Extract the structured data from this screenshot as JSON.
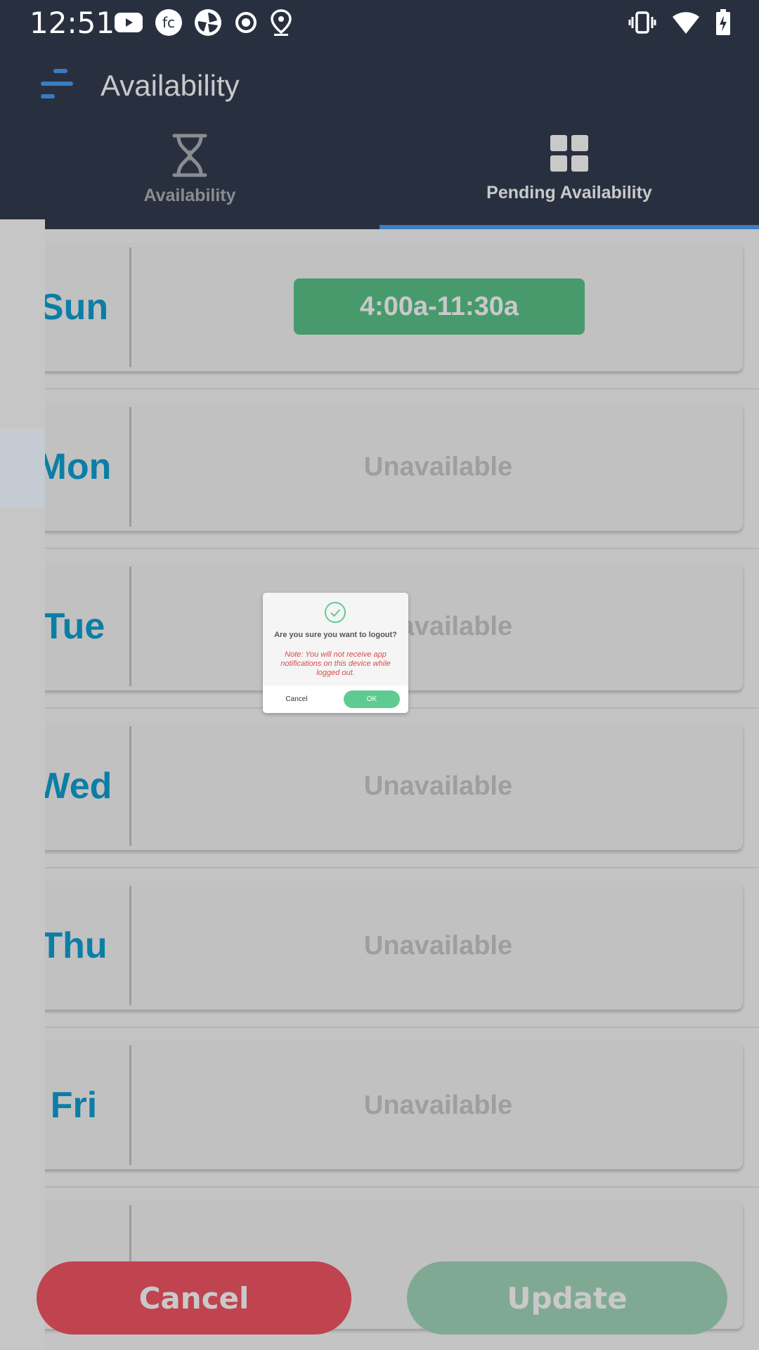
{
  "status_bar": {
    "time": "12:51"
  },
  "header": {
    "title": "Availability"
  },
  "tabs": [
    {
      "label": "Availability",
      "icon": "hourglass-icon",
      "active": false
    },
    {
      "label": "Pending Availability",
      "icon": "grid-icon",
      "active": true
    }
  ],
  "days": [
    {
      "day": "Sun",
      "value": "4:00a-11:30a"
    },
    {
      "day": "Mon",
      "value": "Unavailable"
    },
    {
      "day": "Tue",
      "value": "Unavailable"
    },
    {
      "day": "Wed",
      "value": "Unavailable"
    },
    {
      "day": "Thu",
      "value": "Unavailable"
    },
    {
      "day": "Fri",
      "value": "Unavailable"
    },
    {
      "day": "",
      "value": ""
    }
  ],
  "footer": {
    "cancel_label": "Cancel",
    "update_label": "Update"
  },
  "dialog": {
    "title": "Are you sure you want to logout?",
    "note": "Note: You will not receive app notifications on this device while logged out.",
    "cancel_label": "Cancel",
    "ok_label": "OK"
  },
  "colors": {
    "header_bg": "#283040",
    "day_label": "#0c7ea6",
    "time_pill": "#479a6c",
    "cancel_button": "#c04450",
    "update_button": "#80a994",
    "tab_indicator": "#3d7ebf",
    "dialog_ok": "#5fcb92",
    "dialog_note": "#d84c4c"
  }
}
